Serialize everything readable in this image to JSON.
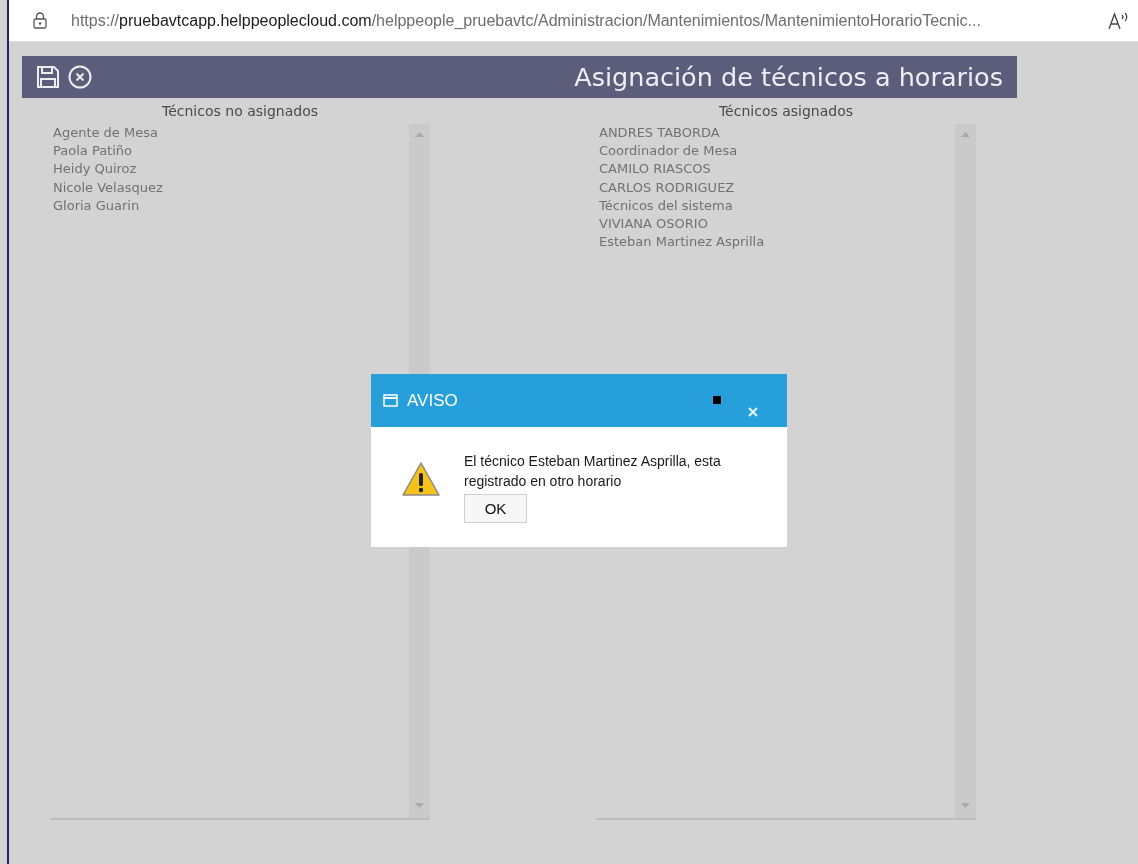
{
  "address_bar": {
    "url": {
      "scheme": "https://",
      "host": "pruebavtcapp.helppeoplecloud.com",
      "path": "/helppeople_pruebavtc/Administracion/Mantenimientos/MantenimientoHorarioTecnic..."
    }
  },
  "header": {
    "title": "Asignación de técnicos a horarios"
  },
  "lists": [
    {
      "title": "Técnicos no asignados",
      "items": [
        "Agente de Mesa",
        "Paola Patiño",
        "Heidy Quiroz",
        "Nicole Velasquez",
        "Gloria Guarin"
      ]
    },
    {
      "title": "Técnicos asignados",
      "items": [
        "ANDRES TABORDA",
        "Coordinador de Mesa",
        "CAMILO RIASCOS",
        "CARLOS RODRIGUEZ",
        "Técnicos del sistema",
        "VIVIANA OSORIO",
        "Esteban Martinez Asprilla"
      ]
    }
  ],
  "dialog": {
    "title": "AVISO",
    "message": "El técnico Esteban Martinez Asprilla, esta registrado en otro horario",
    "button": "OK"
  }
}
